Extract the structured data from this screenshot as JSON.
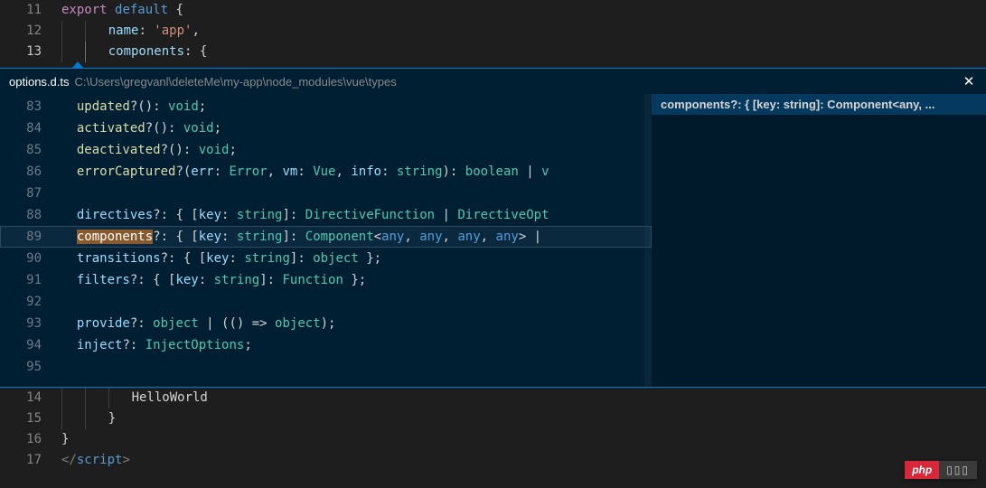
{
  "top_editor": {
    "lines": [
      {
        "num": 11,
        "tokens": [
          [
            "kw-export",
            "export"
          ],
          [
            "punct",
            " "
          ],
          [
            "kw-default",
            "default"
          ],
          [
            "punct",
            " {"
          ]
        ]
      },
      {
        "num": 12,
        "indent": 2,
        "tokens": [
          [
            "prop",
            "name"
          ],
          [
            "punct",
            ": "
          ],
          [
            "str",
            "'app'"
          ],
          [
            "punct",
            ","
          ]
        ]
      },
      {
        "num": 13,
        "indent": 2,
        "active": true,
        "tokens": [
          [
            "prop",
            "components"
          ],
          [
            "punct",
            ": {"
          ]
        ]
      }
    ]
  },
  "peek": {
    "title": "options.d.ts",
    "path": "C:\\Users\\gregvanl\\deleteMe\\my-app\\node_modules\\vue\\types",
    "close": "✕",
    "reference": {
      "label": "components?: { [key: string]: Component<any, ..."
    },
    "lines": [
      {
        "num": 83,
        "tokens": [
          [
            "fn",
            "updated"
          ],
          [
            "punct",
            "?(): "
          ],
          [
            "type",
            "void"
          ],
          [
            "punct",
            ";"
          ]
        ]
      },
      {
        "num": 84,
        "tokens": [
          [
            "fn",
            "activated"
          ],
          [
            "punct",
            "?(): "
          ],
          [
            "type",
            "void"
          ],
          [
            "punct",
            ";"
          ]
        ]
      },
      {
        "num": 85,
        "tokens": [
          [
            "fn",
            "deactivated"
          ],
          [
            "punct",
            "?(): "
          ],
          [
            "type",
            "void"
          ],
          [
            "punct",
            ";"
          ]
        ]
      },
      {
        "num": 86,
        "tokens": [
          [
            "fn",
            "errorCaptured"
          ],
          [
            "punct",
            "?("
          ],
          [
            "prop",
            "err"
          ],
          [
            "punct",
            ": "
          ],
          [
            "type",
            "Error"
          ],
          [
            "punct",
            ", "
          ],
          [
            "prop",
            "vm"
          ],
          [
            "punct",
            ": "
          ],
          [
            "type",
            "Vue"
          ],
          [
            "punct",
            ", "
          ],
          [
            "prop",
            "info"
          ],
          [
            "punct",
            ": "
          ],
          [
            "type",
            "string"
          ],
          [
            "punct",
            "): "
          ],
          [
            "type",
            "boolean"
          ],
          [
            "punct",
            " | "
          ],
          [
            "type",
            "v"
          ]
        ]
      },
      {
        "num": 87,
        "tokens": []
      },
      {
        "num": 88,
        "tokens": [
          [
            "prop",
            "directives"
          ],
          [
            "punct",
            "?: { ["
          ],
          [
            "prop",
            "key"
          ],
          [
            "punct",
            ": "
          ],
          [
            "type",
            "string"
          ],
          [
            "punct",
            "]: "
          ],
          [
            "type",
            "DirectiveFunction"
          ],
          [
            "punct",
            " | "
          ],
          [
            "type",
            "DirectiveOpt"
          ]
        ]
      },
      {
        "num": 89,
        "highlight": true,
        "tokens": [
          [
            "highlight-word",
            "components"
          ],
          [
            "punct",
            "?: { ["
          ],
          [
            "prop",
            "key"
          ],
          [
            "punct",
            ": "
          ],
          [
            "type",
            "string"
          ],
          [
            "punct",
            "]: "
          ],
          [
            "type",
            "Component"
          ],
          [
            "punct",
            "<"
          ],
          [
            "generic",
            "any"
          ],
          [
            "punct",
            ", "
          ],
          [
            "generic",
            "any"
          ],
          [
            "punct",
            ", "
          ],
          [
            "generic",
            "any"
          ],
          [
            "punct",
            ", "
          ],
          [
            "generic",
            "any"
          ],
          [
            "punct",
            "> |"
          ]
        ]
      },
      {
        "num": 90,
        "tokens": [
          [
            "prop",
            "transitions"
          ],
          [
            "punct",
            "?: { ["
          ],
          [
            "prop",
            "key"
          ],
          [
            "punct",
            ": "
          ],
          [
            "type",
            "string"
          ],
          [
            "punct",
            "]: "
          ],
          [
            "type",
            "object"
          ],
          [
            "punct",
            " };"
          ]
        ]
      },
      {
        "num": 91,
        "tokens": [
          [
            "prop",
            "filters"
          ],
          [
            "punct",
            "?: { ["
          ],
          [
            "prop",
            "key"
          ],
          [
            "punct",
            ": "
          ],
          [
            "type",
            "string"
          ],
          [
            "punct",
            "]: "
          ],
          [
            "type",
            "Function"
          ],
          [
            "punct",
            " };"
          ]
        ]
      },
      {
        "num": 92,
        "tokens": []
      },
      {
        "num": 93,
        "tokens": [
          [
            "prop",
            "provide"
          ],
          [
            "punct",
            "?: "
          ],
          [
            "type",
            "object"
          ],
          [
            "punct",
            " | (() => "
          ],
          [
            "type",
            "object"
          ],
          [
            "punct",
            ");"
          ]
        ]
      },
      {
        "num": 94,
        "tokens": [
          [
            "prop",
            "inject"
          ],
          [
            "punct",
            "?: "
          ],
          [
            "type",
            "InjectOptions"
          ],
          [
            "punct",
            ";"
          ]
        ]
      },
      {
        "num": 95,
        "tokens": []
      }
    ]
  },
  "bottom_editor": {
    "lines": [
      {
        "num": 14,
        "indent": 3,
        "tokens": [
          [
            "ident",
            "HelloWorld"
          ]
        ]
      },
      {
        "num": 15,
        "indent": 2,
        "tokens": [
          [
            "punct",
            "}"
          ]
        ]
      },
      {
        "num": 16,
        "indent": 0,
        "tokens": [
          [
            "punct",
            "}"
          ]
        ]
      },
      {
        "num": 17,
        "indent": 0,
        "tokens": [
          [
            "tag",
            "</"
          ],
          [
            "kw-default",
            "script"
          ],
          [
            "tag",
            ">"
          ]
        ]
      }
    ]
  },
  "watermark": {
    "left": "php",
    "right": "▯▯▯"
  }
}
